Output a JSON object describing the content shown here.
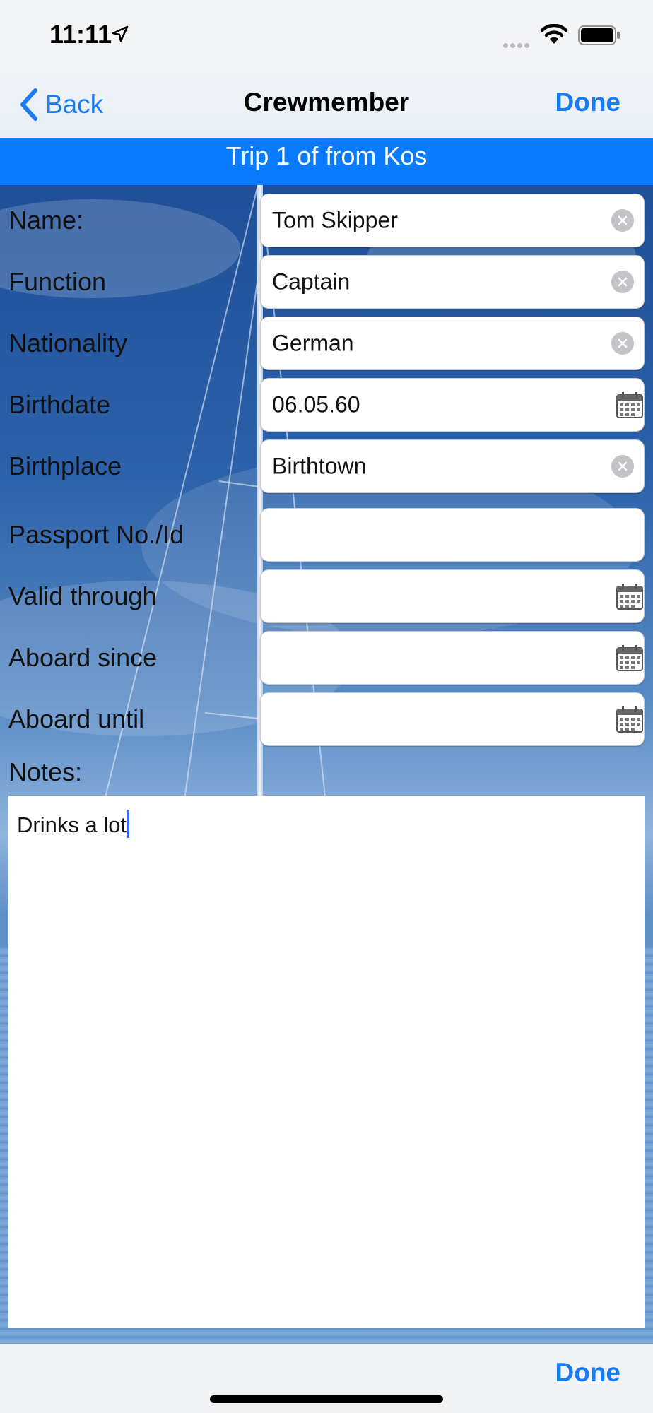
{
  "status_bar": {
    "time": "11:11",
    "icons": [
      "location-arrow-icon",
      "signal-dots-icon",
      "wifi-icon",
      "battery-icon"
    ]
  },
  "nav": {
    "back_label": "Back",
    "title": "Crewmember",
    "done_label": "Done"
  },
  "trip_banner": "Trip 1 of from Kos",
  "form": {
    "rows": [
      {
        "label": "Name:",
        "value": "Tom Skipper",
        "accessory": "clear"
      },
      {
        "label": "Function",
        "value": "Captain",
        "accessory": "clear"
      },
      {
        "label": "Nationality",
        "value": "German",
        "accessory": "clear"
      },
      {
        "label": "Birthdate",
        "value": "06.05.60",
        "accessory": "calendar"
      },
      {
        "label": "Birthplace",
        "value": "Birthtown",
        "accessory": "clear"
      },
      {
        "label": "Passport No./Id",
        "value": "",
        "accessory": "none"
      },
      {
        "label": "Valid through",
        "value": "",
        "accessory": "calendar"
      },
      {
        "label": "Aboard since",
        "value": "",
        "accessory": "calendar"
      },
      {
        "label": "Aboard until",
        "value": "",
        "accessory": "calendar"
      }
    ]
  },
  "notes": {
    "label": "Notes:",
    "value": "Drinks a lot"
  },
  "bottom_bar": {
    "done_label": "Done"
  },
  "colors": {
    "accent": "#1a7cf5",
    "banner": "#0a7bff"
  }
}
